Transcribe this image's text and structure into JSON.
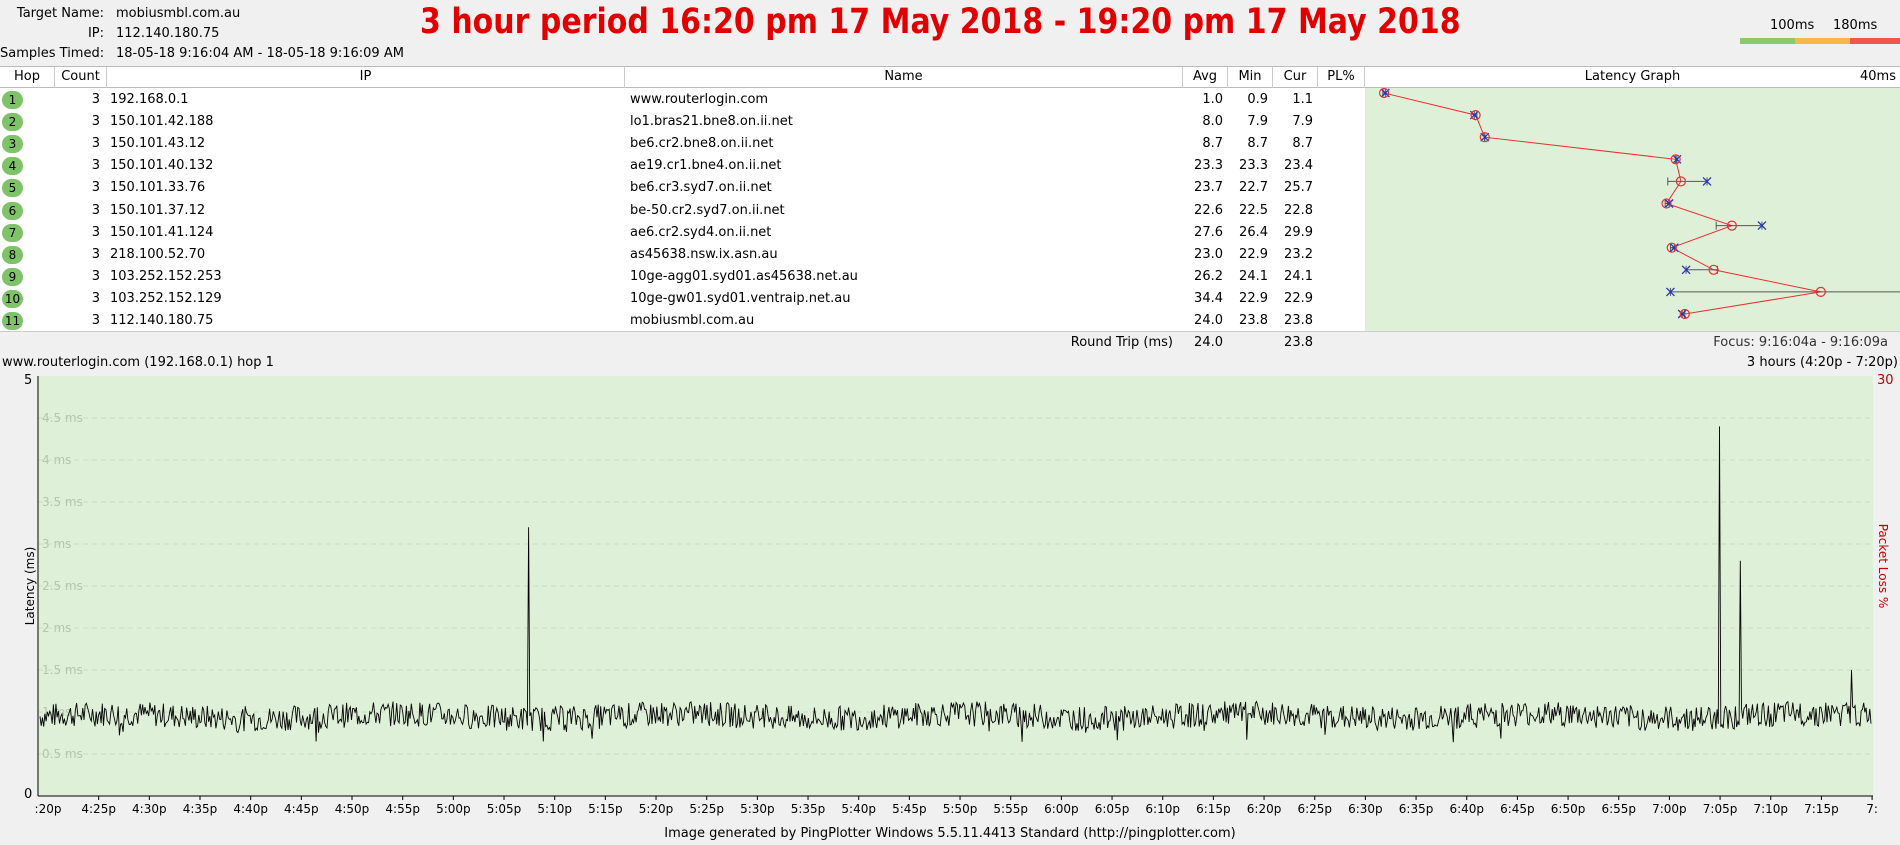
{
  "target": {
    "name_label": "Target Name:",
    "name": "mobiusmbl.com.au",
    "ip_label": "IP:",
    "ip": "112.140.180.75",
    "samples_label": "Samples Timed:",
    "samples": "18-05-18 9:16:04 AM - 18-05-18 9:16:09 AM"
  },
  "banner_title": "3 hour period 16:20 pm 17 May 2018 - 19:20 pm 17 May 2018",
  "legend": {
    "label_100": "100ms",
    "label_180": "180ms",
    "colors": [
      "#8dc96a",
      "#f9b64b",
      "#f0574a"
    ]
  },
  "columns": {
    "hop": "Hop",
    "count": "Count",
    "ip": "IP",
    "name": "Name",
    "avg": "Avg",
    "min": "Min",
    "cur": "Cur",
    "pl": "PL%",
    "latency_graph": "Latency Graph",
    "scale_max": "40ms"
  },
  "hops": [
    {
      "hop": "1",
      "count": "3",
      "ip": "192.168.0.1",
      "name": "www.routerlogin.com",
      "avg": "1.0",
      "min": "0.9",
      "cur": "1.1",
      "pl": ""
    },
    {
      "hop": "2",
      "count": "3",
      "ip": "150.101.42.188",
      "name": "lo1.bras21.bne8.on.ii.net",
      "avg": "8.0",
      "min": "7.9",
      "cur": "7.9",
      "pl": ""
    },
    {
      "hop": "3",
      "count": "3",
      "ip": "150.101.43.12",
      "name": "be6.cr2.bne8.on.ii.net",
      "avg": "8.7",
      "min": "8.7",
      "cur": "8.7",
      "pl": ""
    },
    {
      "hop": "4",
      "count": "3",
      "ip": "150.101.40.132",
      "name": "ae19.cr1.bne4.on.ii.net",
      "avg": "23.3",
      "min": "23.3",
      "cur": "23.4",
      "pl": ""
    },
    {
      "hop": "5",
      "count": "3",
      "ip": "150.101.33.76",
      "name": "be6.cr3.syd7.on.ii.net",
      "avg": "23.7",
      "min": "22.7",
      "cur": "25.7",
      "pl": ""
    },
    {
      "hop": "6",
      "count": "3",
      "ip": "150.101.37.12",
      "name": "be-50.cr2.syd7.on.ii.net",
      "avg": "22.6",
      "min": "22.5",
      "cur": "22.8",
      "pl": ""
    },
    {
      "hop": "7",
      "count": "3",
      "ip": "150.101.41.124",
      "name": "ae6.cr2.syd4.on.ii.net",
      "avg": "27.6",
      "min": "26.4",
      "cur": "29.9",
      "pl": ""
    },
    {
      "hop": "8",
      "count": "3",
      "ip": "218.100.52.70",
      "name": "as45638.nsw.ix.asn.au",
      "avg": "23.0",
      "min": "22.9",
      "cur": "23.2",
      "pl": ""
    },
    {
      "hop": "9",
      "count": "3",
      "ip": "103.252.152.253",
      "name": "10ge-agg01.syd01.as45638.net.au",
      "avg": "26.2",
      "min": "24.1",
      "cur": "24.1",
      "pl": ""
    },
    {
      "hop": "10",
      "count": "3",
      "ip": "103.252.152.129",
      "name": "10ge-gw01.syd01.ventraip.net.au",
      "avg": "34.4",
      "min": "22.9",
      "cur": "22.9",
      "pl": ""
    },
    {
      "hop": "11",
      "count": "3",
      "ip": "112.140.180.75",
      "name": "mobiusmbl.com.au",
      "avg": "24.0",
      "min": "23.8",
      "cur": "23.8",
      "pl": ""
    }
  ],
  "hop_graph_max_ms": [
    1.1,
    8.1,
    8.7,
    23.4,
    25.7,
    22.8,
    29.9,
    23.2,
    26.5,
    52.0,
    24.0
  ],
  "roundtrip": {
    "label": "Round Trip (ms)",
    "avg": "24.0",
    "cur": "23.8",
    "focus": "Focus: 9:16:04a - 9:16:09a"
  },
  "detail": {
    "target_label": "www.routerlogin.com (192.168.0.1) hop 1",
    "period_label": "3 hours (4:20p - 7:20p)",
    "right_axis_max": "30",
    "left_axis_max": "5",
    "left_axis_min": "0",
    "y_axis_title": "Latency (ms)",
    "right_axis_title": "Packet Loss %"
  },
  "chart_data": {
    "type": "line",
    "title": "",
    "xlabel": "",
    "ylabel": "Latency (ms)",
    "ylim": [
      0,
      5
    ],
    "y_ticks": [
      "0.5 ms",
      "1 ms",
      "1.5 ms",
      "2 ms",
      "2.5 ms",
      "3 ms",
      "3.5 ms",
      "4 ms",
      "4.5 ms"
    ],
    "x_ticks": [
      ":20p",
      "4:25p",
      "4:30p",
      "4:35p",
      "4:40p",
      "4:45p",
      "4:50p",
      "4:55p",
      "5:00p",
      "5:05p",
      "5:10p",
      "5:15p",
      "5:20p",
      "5:25p",
      "5:30p",
      "5:35p",
      "5:40p",
      "5:45p",
      "5:50p",
      "5:55p",
      "6:00p",
      "6:05p",
      "6:10p",
      "6:15p",
      "6:20p",
      "6:25p",
      "6:30p",
      "6:35p",
      "6:40p",
      "6:45p",
      "6:50p",
      "6:55p",
      "7:00p",
      "7:05p",
      "7:10p",
      "7:15p",
      "7:"
    ],
    "baseline_ms": 0.95,
    "noise_ms": 0.15,
    "spikes": [
      {
        "time": "5:08p",
        "value": 3.2
      },
      {
        "time": "7:05p",
        "value": 4.4
      },
      {
        "time": "7:07p",
        "value": 2.8
      },
      {
        "time": "7:18p",
        "value": 1.5
      }
    ],
    "grid": true
  },
  "footer": "Image generated by PingPlotter Windows 5.5.11.4413 Standard (http://pingplotter.com)"
}
